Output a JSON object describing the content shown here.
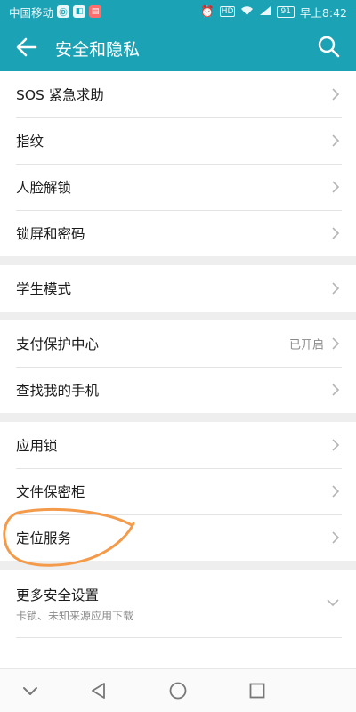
{
  "status_bar": {
    "carrier": "中国移动",
    "badges": [
      "app-notification-icon",
      "app-notification-icon",
      "app-notification-icon"
    ],
    "right_icons": [
      "alarm-icon",
      "hd-icon",
      "wifi-icon",
      "signal-icon"
    ],
    "battery": "91",
    "time": "早上8:42"
  },
  "header": {
    "title": "安全和隐私",
    "back_icon": "back-arrow-icon",
    "search_icon": "search-icon"
  },
  "groups": [
    [
      {
        "label": "SOS 紧急求助"
      },
      {
        "label": "指纹"
      },
      {
        "label": "人脸解锁"
      },
      {
        "label": "锁屏和密码"
      }
    ],
    [
      {
        "label": "学生模式"
      }
    ],
    [
      {
        "label": "支付保护中心",
        "value": "已开启"
      },
      {
        "label": "查找我的手机"
      }
    ],
    [
      {
        "label": "应用锁"
      },
      {
        "label": "文件保密柜"
      },
      {
        "label": "定位服务"
      }
    ]
  ],
  "more": {
    "label": "更多安全设置",
    "subtitle": "卡锁、未知来源应用下载"
  },
  "nav": [
    "collapse-icon",
    "back-triangle-icon",
    "home-circle-icon",
    "recents-square-icon"
  ],
  "colors": {
    "accent": "#1ba3b5",
    "annotation": "#f39a4b"
  }
}
